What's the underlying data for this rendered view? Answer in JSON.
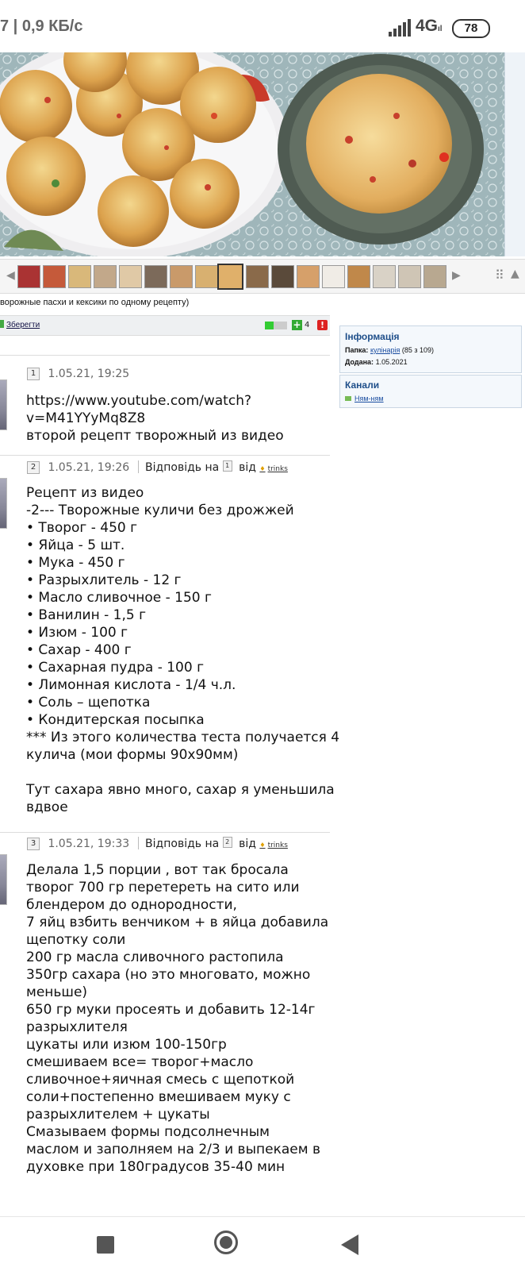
{
  "status_bar": {
    "speed": "7 | 0,9 КБ/с",
    "network": "4G",
    "network_suffix": "ıl",
    "battery": "78"
  },
  "photo_caption": "ворожные пасхи и кексики по одному рецепту)",
  "toolbar": {
    "save_label": "Зберегти",
    "count": "4"
  },
  "info": {
    "title": "Інформація",
    "folder_label": "Папка:",
    "folder_value": "кулінарія",
    "folder_count": "(85 з 109)",
    "added_label": "Додана:",
    "added_value": "1.05.2021"
  },
  "channels": {
    "title": "Канали",
    "item": "Ням-ням"
  },
  "posts": [
    {
      "num": "1",
      "date": "1.05.21, 19:25",
      "lines": [
        "https://www.youtube.com/watch?",
        "v=M41YYyMq8Z8",
        "второй рецепт творожный из видео"
      ]
    },
    {
      "num": "2",
      "date": "1.05.21, 19:26",
      "reply_prefix": "Відповідь на",
      "reply_num": "1",
      "reply_from": "від",
      "reply_user": "trinks",
      "lines": [
        "Рецепт из видео",
        "-2--- Творожные куличи без дрожжей",
        "• Творог - 450 г",
        "• Яйца - 5 шт.",
        "• Мука - 450 г",
        "• Разрыхлитель - 12 г",
        "• Масло сливочное - 150 г",
        "• Ванилин - 1,5 г",
        "• Изюм - 100 г",
        "• Сахар - 400 г",
        "• Сахарная пудра - 100 г",
        "• Лимонная кислота - 1/4 ч.л.",
        "• Соль – щепотка",
        "• Кондитерская посыпка",
        "*** Из этого количества теста получается 4",
        "кулича (мои формы 90х90мм)",
        "",
        "Тут сахара явно много, сахар я уменьшила",
        "вдвое"
      ]
    },
    {
      "num": "3",
      "date": "1.05.21, 19:33",
      "reply_prefix": "Відповідь на",
      "reply_num": "2",
      "reply_from": "від",
      "reply_user": "trinks",
      "lines": [
        "Делала 1,5 порции , вот так бросала",
        "творог 700 гр перетереть на сито или",
        "блендером до однородности,",
        "7 яйц взбить венчиком + в яйца добавила",
        "щепотку соли",
        "200 гр масла сливочного растопила",
        "350гр сахара (но это многовато, можно",
        "меньше)",
        "650 гр муки просеять и добавить 12-14г",
        "разрыхлителя",
        "цукаты или изюм 100-150гр",
        "смешиваем все= творог+масло",
        "сливочное+яичная смесь с щепоткой",
        "соли+постепенно вмешиваем муку с",
        "разрыхлителем + цукаты",
        "Смазываем формы подсолнечным",
        "маслом и заполняем на 2/3 и выпекаем в",
        "духовке при 180градусов 35-40 мин"
      ]
    }
  ]
}
